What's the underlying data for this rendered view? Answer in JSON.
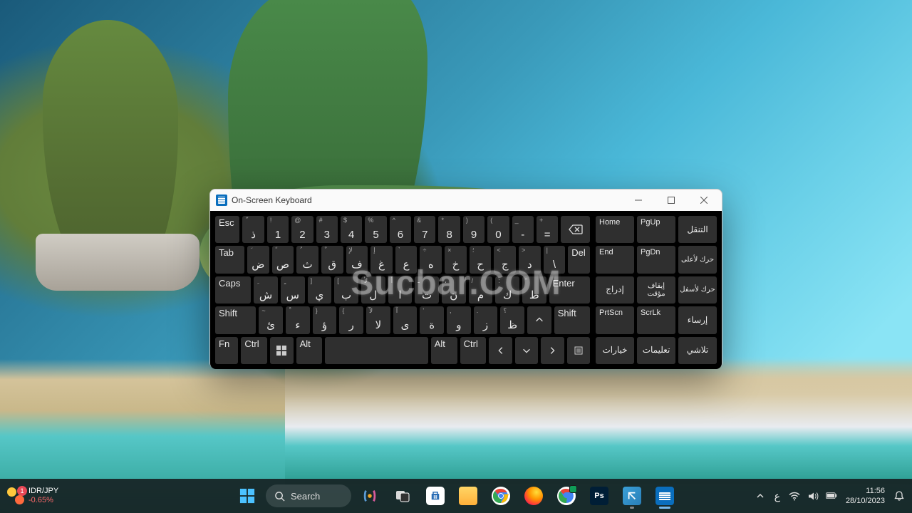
{
  "window": {
    "title": "On-Screen Keyboard"
  },
  "keys": {
    "esc": "Esc",
    "tab": "Tab",
    "caps": "Caps",
    "shiftL": "Shift",
    "shiftR": "Shift",
    "fn": "Fn",
    "ctrlL": "Ctrl",
    "ctrlR": "Ctrl",
    "altL": "Alt",
    "altR": "Alt",
    "enter": "Enter",
    "del": "Del",
    "backspace": "⌫",
    "row1": [
      {
        "m": "ذ",
        "s": "ّ"
      },
      {
        "m": "1",
        "s": "!"
      },
      {
        "m": "2",
        "s": "@"
      },
      {
        "m": "3",
        "s": "#"
      },
      {
        "m": "4",
        "s": "$"
      },
      {
        "m": "5",
        "s": "%"
      },
      {
        "m": "6",
        "s": "^"
      },
      {
        "m": "7",
        "s": "&"
      },
      {
        "m": "8",
        "s": "*"
      },
      {
        "m": "9",
        "s": ")"
      },
      {
        "m": "0",
        "s": "("
      },
      {
        "m": "-",
        "s": "_"
      },
      {
        "m": "=",
        "s": "+"
      }
    ],
    "row2": [
      {
        "m": "ض",
        "s": "َ"
      },
      {
        "m": "ص",
        "s": "ً"
      },
      {
        "m": "ث",
        "s": "ُ"
      },
      {
        "m": "ق",
        "s": "ٌ"
      },
      {
        "m": "ف",
        "s": "لإ"
      },
      {
        "m": "غ",
        "s": "إ"
      },
      {
        "m": "ع",
        "s": "`"
      },
      {
        "m": "ه",
        "s": "÷"
      },
      {
        "m": "خ",
        "s": "×"
      },
      {
        "m": "ح",
        "s": "؛"
      },
      {
        "m": "ج",
        "s": "<"
      },
      {
        "m": "د",
        "s": ">"
      },
      {
        "m": "\\",
        "s": "|"
      }
    ],
    "row3": [
      {
        "m": "ش",
        "s": "ِ"
      },
      {
        "m": "س",
        "s": "ٍ"
      },
      {
        "m": "ي",
        "s": "]"
      },
      {
        "m": "ب",
        "s": "["
      },
      {
        "m": "ل",
        "s": "لأ"
      },
      {
        "m": "ا",
        "s": "أ"
      },
      {
        "m": "ت",
        "s": "ـ"
      },
      {
        "m": "ن",
        "s": "،"
      },
      {
        "m": "م",
        "s": "/"
      },
      {
        "m": "ك",
        "s": ":"
      },
      {
        "m": "ط",
        "s": "\""
      }
    ],
    "row4": [
      {
        "m": "ئ",
        "s": "~"
      },
      {
        "m": "ء",
        "s": "ْ"
      },
      {
        "m": "ؤ",
        "s": "}"
      },
      {
        "m": "ر",
        "s": "{"
      },
      {
        "m": "لا",
        "s": "لآ"
      },
      {
        "m": "ى",
        "s": "آ"
      },
      {
        "m": "ة",
        "s": "'"
      },
      {
        "m": "و",
        "s": ","
      },
      {
        "m": "ز",
        "s": "."
      },
      {
        "m": "ظ",
        "s": "؟"
      }
    ],
    "side": {
      "home": "Home",
      "pgup": "PgUp",
      "nav": "التنقل",
      "end": "End",
      "pgdn": "PgDn",
      "mvup": "حرك لأعلى",
      "insert": "إدراج",
      "pause": "إيقاف مؤقت",
      "mvdn": "حرك لأسفل",
      "prtscn": "PrtScn",
      "scrlk": "ScrLk",
      "dock": "إرساء",
      "options": "خيارات",
      "help": "تعليمات",
      "fade": "تلاشي"
    }
  },
  "taskbar": {
    "widget": {
      "badge": "1",
      "line1": "IDR/JPY",
      "line2": "-0.65%"
    },
    "search": "Search",
    "lang": "ع",
    "clock": {
      "time": "11:56",
      "date": "28/10/2023"
    }
  },
  "watermark": "Sucbar.COM"
}
